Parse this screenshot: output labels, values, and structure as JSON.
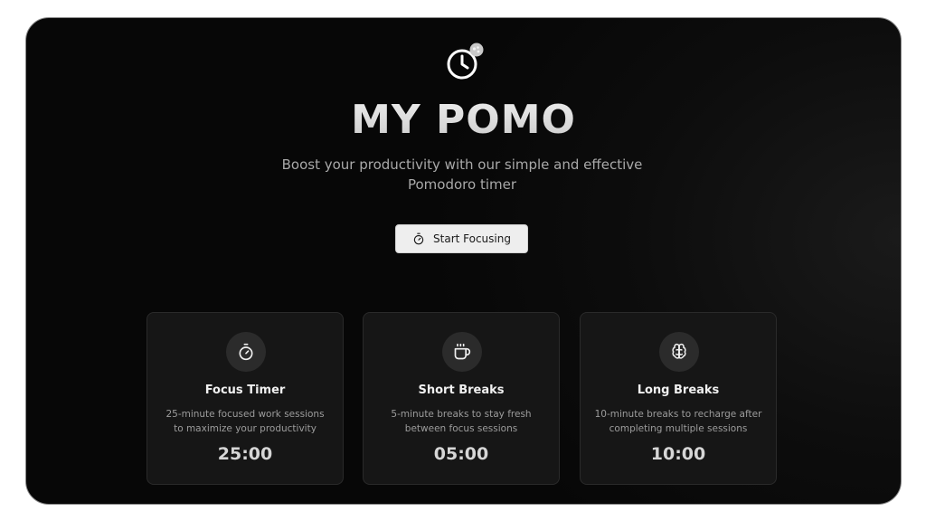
{
  "hero": {
    "logo_icon": "clock-icon",
    "title": "MY POMO",
    "subtitle": "Boost your productivity with our simple and effective Pomodoro timer",
    "cta_icon": "stopwatch-icon",
    "cta_label": "Start Focusing"
  },
  "features": [
    {
      "icon": "stopwatch-icon",
      "title": "Focus Timer",
      "description": "25-minute focused work sessions to maximize your productivity",
      "time": "25:00"
    },
    {
      "icon": "coffee-cup-icon",
      "title": "Short Breaks",
      "description": "5-minute breaks to stay fresh between focus sessions",
      "time": "05:00"
    },
    {
      "icon": "brain-icon",
      "title": "Long Breaks",
      "description": "10-minute breaks to recharge after completing multiple sessions",
      "time": "10:00"
    }
  ],
  "colors": {
    "background": "#0b0b0b",
    "card": "#161616",
    "accent": "#eeeeee"
  }
}
